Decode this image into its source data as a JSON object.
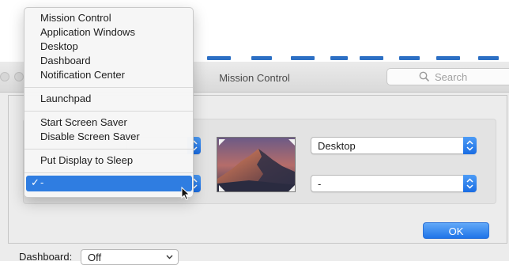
{
  "window": {
    "title": "Mission Control"
  },
  "search": {
    "placeholder": "Search"
  },
  "hot_corners": {
    "left_top_value": "",
    "left_bottom_value": "-",
    "right_top_value": "Desktop",
    "right_bottom_value": "-"
  },
  "buttons": {
    "ok_label": "OK"
  },
  "background_row": {
    "label": "Dashboard:",
    "value": "Off"
  },
  "menu": {
    "items": [
      "Mission Control",
      "Application Windows",
      "Desktop",
      "Dashboard",
      "Notification Center",
      "Launchpad",
      "Start Screen Saver",
      "Disable Screen Saver",
      "Put Display to Sleep"
    ],
    "selected": {
      "check": "✓",
      "label": "-"
    }
  },
  "colors": {
    "accent": "#2f7de1",
    "button_blue": "#1f74e8"
  },
  "icons": [
    "search-icon",
    "checkmark-icon",
    "chevron-updown-icon",
    "cursor-icon"
  ]
}
